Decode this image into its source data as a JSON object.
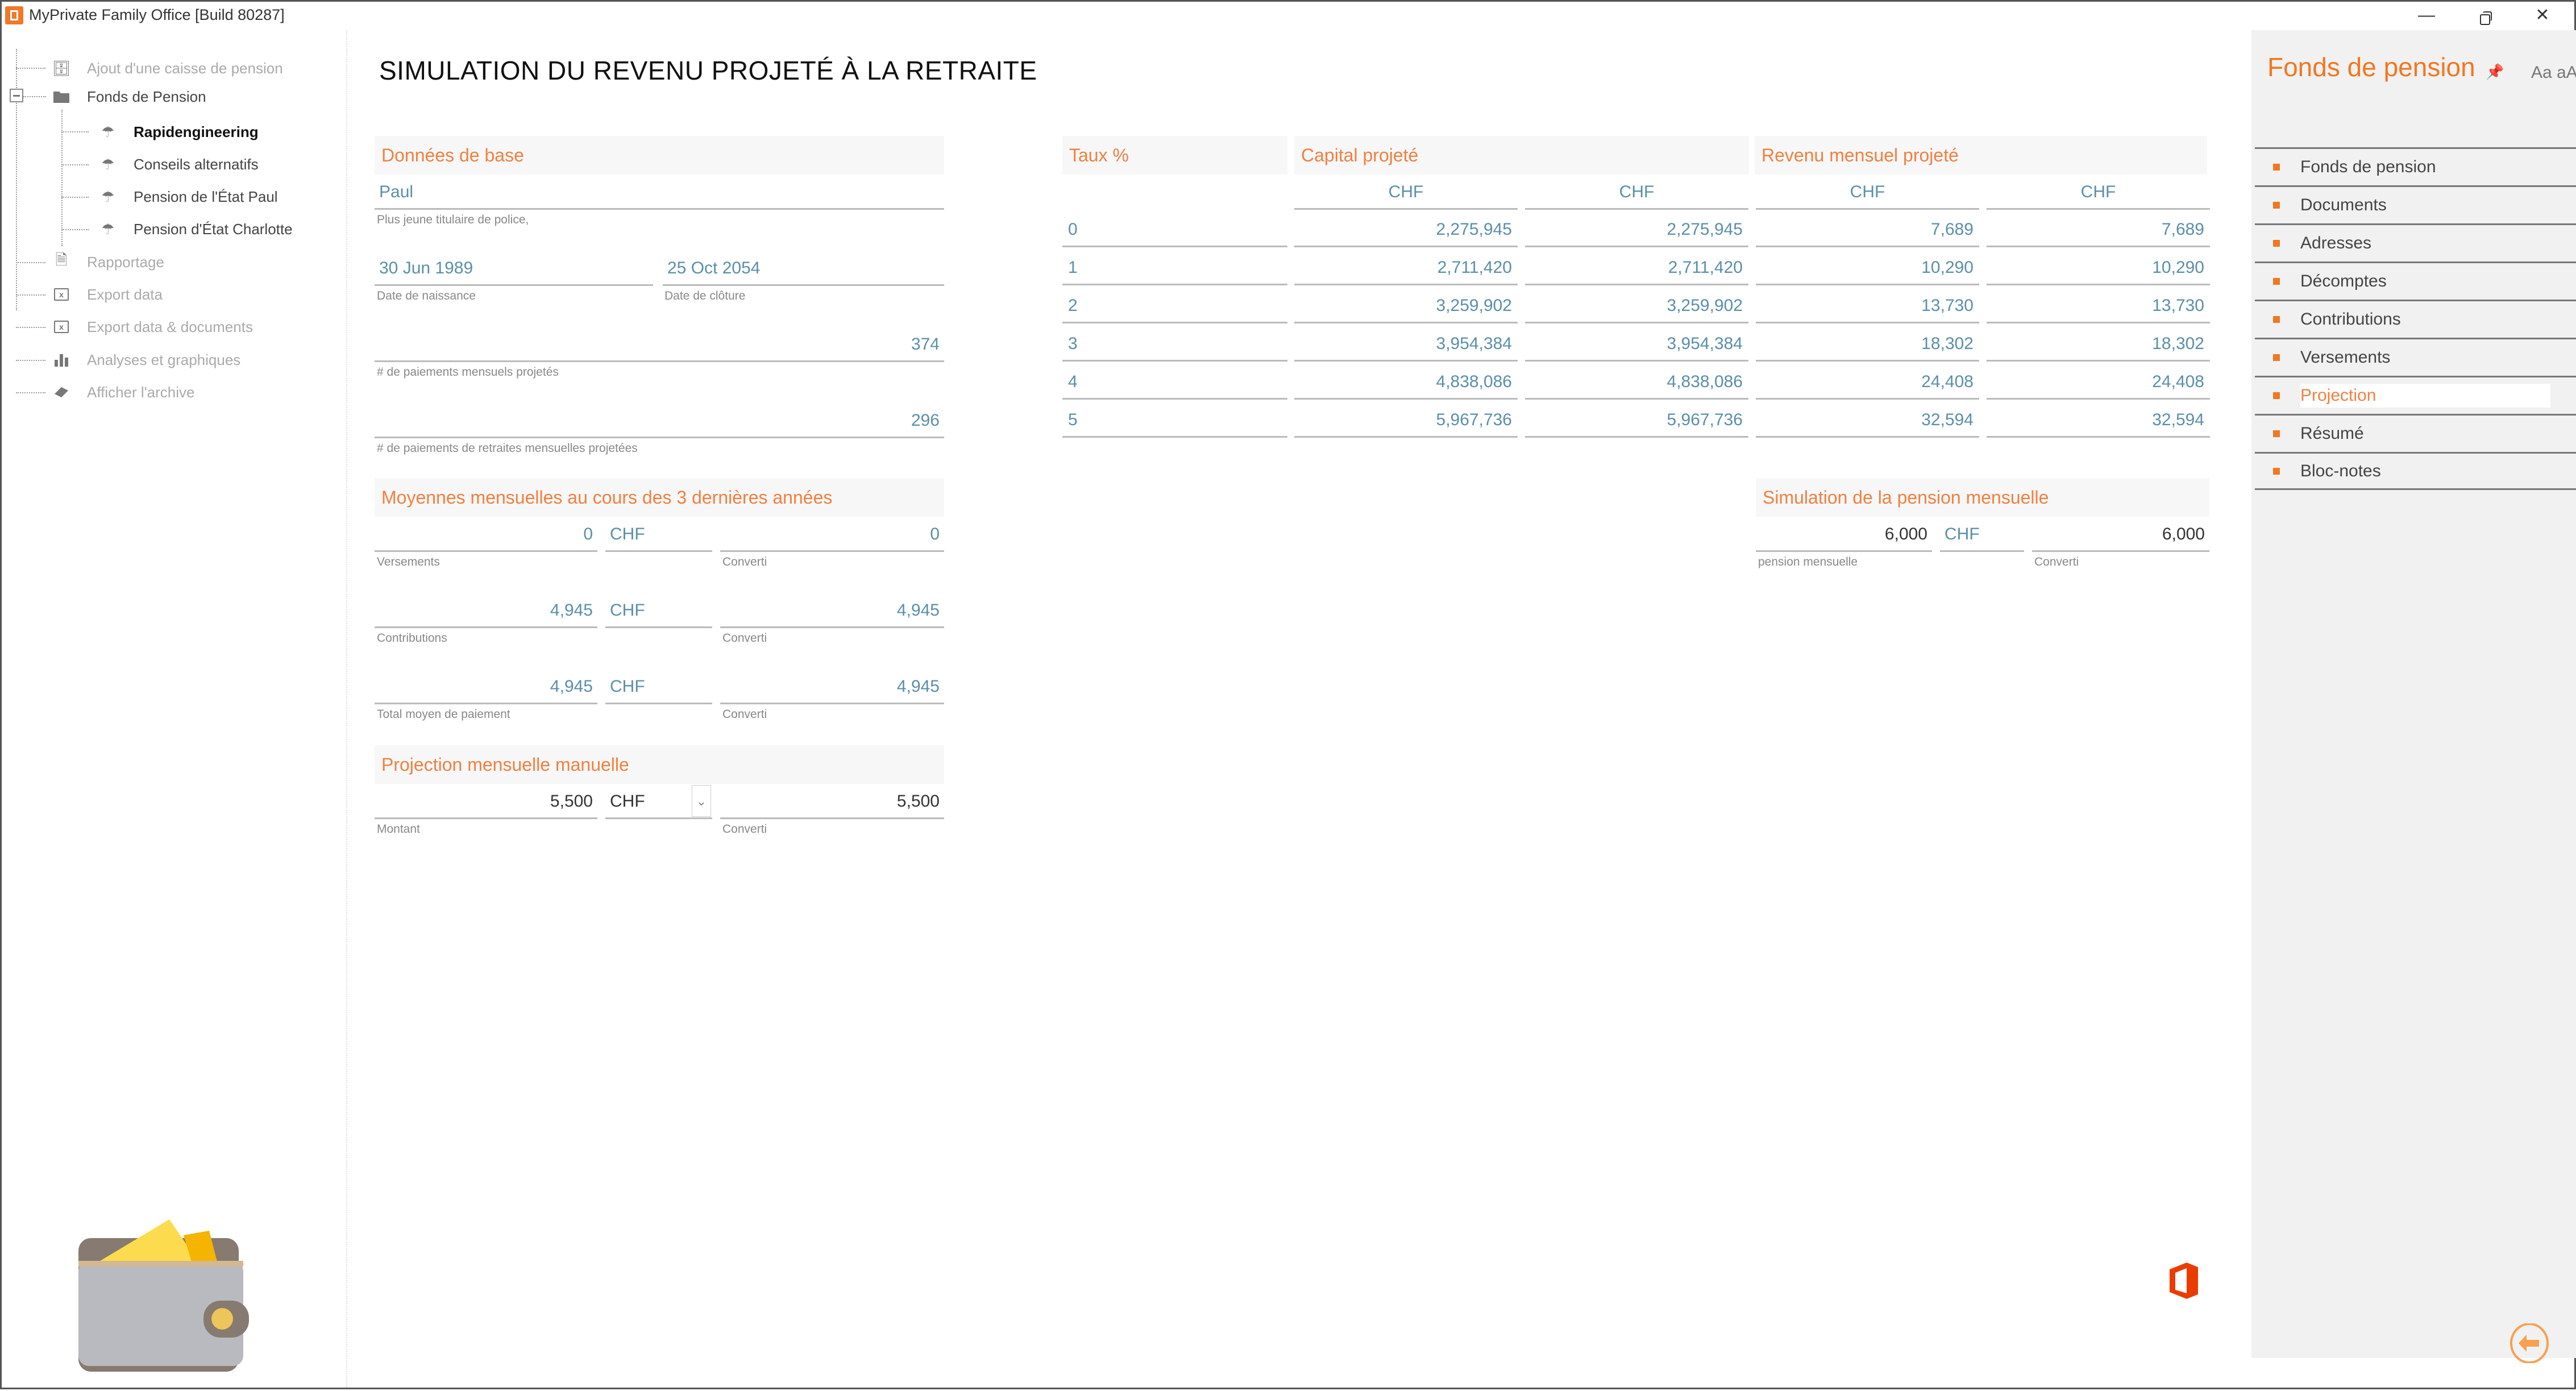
{
  "window": {
    "title": "MyPrivate Family Office [Build 80287]",
    "minimize_icon": "minimize-icon",
    "restore_icon": "restore-icon",
    "close_icon": "close-icon"
  },
  "nav": {
    "items": [
      {
        "label": "Ajout d'une caisse de pension",
        "icon": "add-pension-icon"
      },
      {
        "label": "Fonds de Pension",
        "icon": "folder-icon",
        "expanded": true,
        "children": [
          {
            "label": "Rapidengineering",
            "icon": "umbrella-icon",
            "selected": true
          },
          {
            "label": "Conseils alternatifs",
            "icon": "umbrella-icon"
          },
          {
            "label": "Pension de l'État Paul",
            "icon": "umbrella-icon"
          },
          {
            "label": "Pension d'État Charlotte",
            "icon": "umbrella-icon"
          }
        ]
      },
      {
        "label": "Rapportage",
        "icon": "report-icon"
      },
      {
        "label": "Export data",
        "icon": "excel-icon"
      },
      {
        "label": "Export data & documents",
        "icon": "excel-icon"
      },
      {
        "label": "Analyses et graphiques",
        "icon": "bar-chart-icon"
      },
      {
        "label": "Afficher l'archive",
        "icon": "archive-book-icon"
      }
    ]
  },
  "main": {
    "title": "SIMULATION DU REVENU PROJETÉ À LA RETRAITE",
    "base_data": {
      "heading": "Données de base",
      "holder_value": "Paul",
      "holder_label": "Plus jeune titulaire de police,",
      "birth_date_value": "30 Jun 1989",
      "birth_date_label": "Date de naissance",
      "closing_date_value": "25 Oct 2054",
      "closing_date_label": "Date de clôture",
      "projected_payments_value": "374",
      "projected_payments_label": "# de paiements mensuels projetés",
      "retirement_payments_value": "296",
      "retirement_payments_label": "# de paiements de retraites mensuelles projetées"
    },
    "averages": {
      "heading": "Moyennes mensuelles au cours des 3 dernières années",
      "rows": [
        {
          "value": "0",
          "currency": "CHF",
          "converted": "0",
          "label": "Versements",
          "converted_label": "Converti"
        },
        {
          "value": "4,945",
          "currency": "CHF",
          "converted": "4,945",
          "label": "Contributions",
          "converted_label": "Converti"
        },
        {
          "value": "4,945",
          "currency": "CHF",
          "converted": "4,945",
          "label": "Total moyen de paiement",
          "converted_label": "Converti"
        }
      ]
    },
    "manual_projection": {
      "heading": "Projection mensuelle manuelle",
      "amount": "5,500",
      "currency": "CHF",
      "converted": "5,500",
      "amount_label": "Montant",
      "converted_label": "Converti"
    },
    "projection_table": {
      "rate_header": "Taux %",
      "capital_header": "Capital projeté",
      "income_header": "Revenu mensuel projeté",
      "currency_headers": [
        "CHF",
        "CHF",
        "CHF",
        "CHF"
      ],
      "rows": [
        {
          "rate": "0",
          "capital": "2,275,945",
          "capital_conv": "2,275,945",
          "income": "7,689",
          "income_conv": "7,689"
        },
        {
          "rate": "1",
          "capital": "2,711,420",
          "capital_conv": "2,711,420",
          "income": "10,290",
          "income_conv": "10,290"
        },
        {
          "rate": "2",
          "capital": "3,259,902",
          "capital_conv": "3,259,902",
          "income": "13,730",
          "income_conv": "13,730"
        },
        {
          "rate": "3",
          "capital": "3,954,384",
          "capital_conv": "3,954,384",
          "income": "18,302",
          "income_conv": "18,302"
        },
        {
          "rate": "4",
          "capital": "4,838,086",
          "capital_conv": "4,838,086",
          "income": "24,408",
          "income_conv": "24,408"
        },
        {
          "rate": "5",
          "capital": "5,967,736",
          "capital_conv": "5,967,736",
          "income": "32,594",
          "income_conv": "32,594"
        }
      ]
    },
    "pension_simulation": {
      "heading": "Simulation de la pension mensuelle",
      "value": "6,000",
      "currency": "CHF",
      "converted": "6,000",
      "label": "pension mensuelle",
      "converted_label": "Converti"
    }
  },
  "right_panel": {
    "title": "Fonds de pension",
    "font_size_toggle": "Aa aA",
    "items": [
      {
        "label": "Fonds de pension"
      },
      {
        "label": "Documents"
      },
      {
        "label": "Adresses"
      },
      {
        "label": "Décomptes"
      },
      {
        "label": "Contributions"
      },
      {
        "label": "Versements"
      },
      {
        "label": "Projection",
        "active": true
      },
      {
        "label": "Résumé"
      },
      {
        "label": "Bloc-notes"
      }
    ]
  },
  "colors": {
    "accent_orange": "#f07820",
    "section_heading": "#f08040",
    "value_blue": "#5a8fa8",
    "panel_bg": "#f1f1f1",
    "office_red": "#eb3c00"
  }
}
